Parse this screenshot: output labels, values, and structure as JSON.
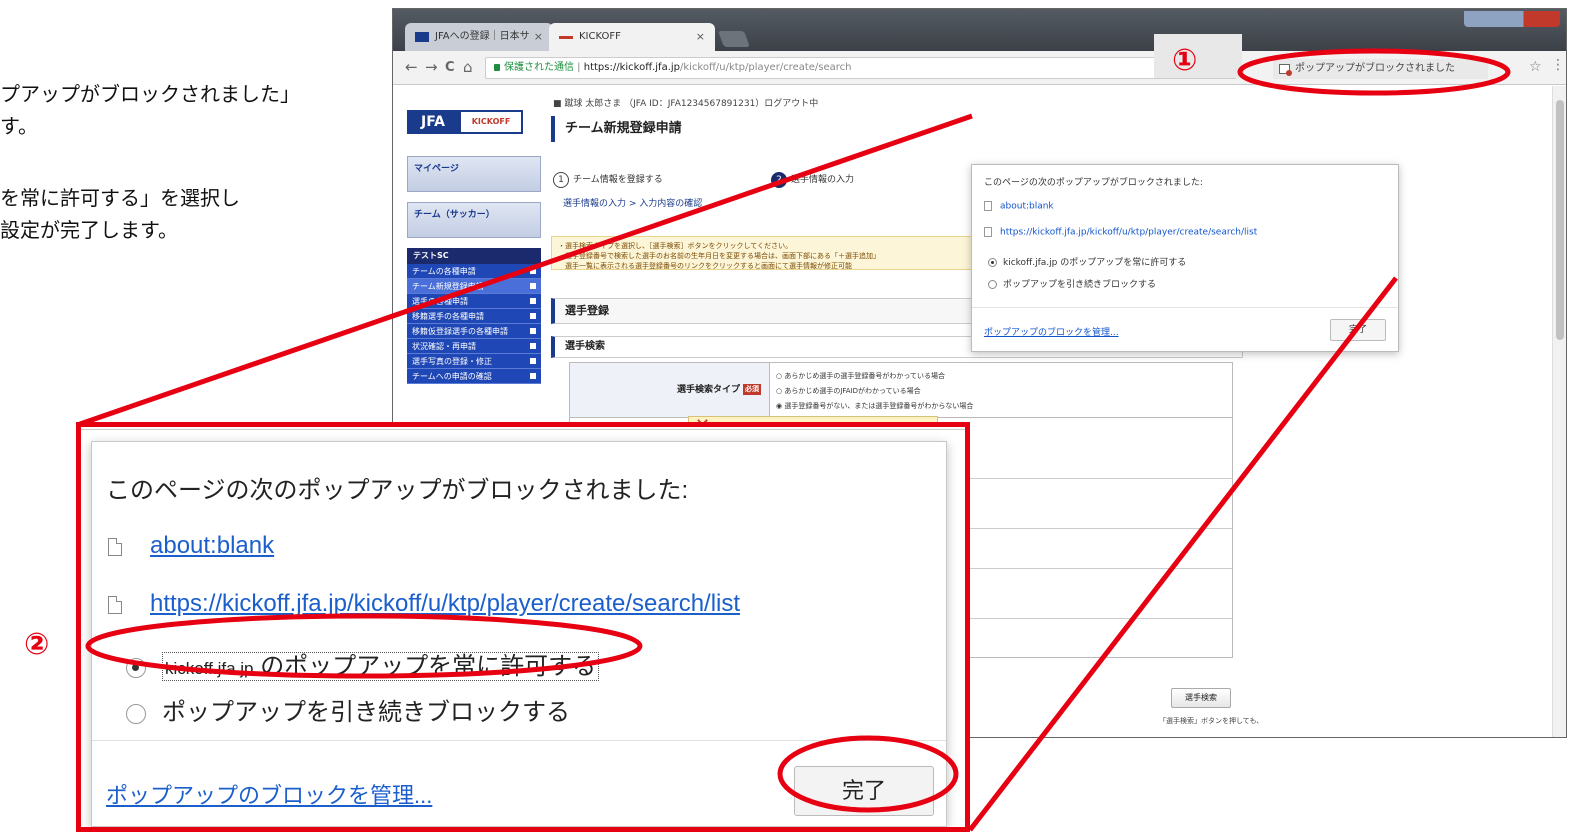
{
  "instructions": {
    "line1": "プアップがブロックされました」",
    "line2": "す。",
    "line3": "を常に許可する」を選択し",
    "line4": "設定が完了します。"
  },
  "browser": {
    "tabs": [
      {
        "label": "JFAへの登録｜日本サ"
      },
      {
        "label": "KICKOFF"
      }
    ],
    "tab_close": "×",
    "nav": {
      "back": "←",
      "forward": "→",
      "reload": "C",
      "home": "⌂"
    },
    "address": {
      "secure_label": "保護された通信",
      "host": "https://kickoff.jfa.jp",
      "path": "/kickoff/u/ktp/player/create/search"
    },
    "blocked_indicator": "ポップアップがブロックされました",
    "star": "☆",
    "menu": "⋮"
  },
  "page": {
    "logo_left": "JFA",
    "logo_right": "KICKOFF",
    "user_line": "■ 蹴球 太郎さま （JFA ID：JFA1234567891231）ログアウト中",
    "heading": "チーム新規登録申請",
    "sidenav": {
      "card1": "マイページ",
      "card2": "チーム（サッカー）",
      "head": "テストSC",
      "items": [
        "チームの各種申請",
        "チーム新規登録申請",
        "選手の各種申請",
        "移籍選手の各種申請",
        "移籍仮登録選手の各種申請",
        "状況確認・再申請",
        "選手写真の登録・修正",
        "チームへの申請の確認"
      ]
    },
    "steps": {
      "step1_num": "1",
      "step1": "チーム情報を登録する",
      "step1_sub": "選手情報の入力 > 入力内容の確認",
      "step2_num": "2",
      "step2": "選手情報の入力"
    },
    "notice": [
      "・選手検索タイプを選択し、［選手検索］ボタンをクリックしてください。",
      "　選手登録番号で検索した選手のお名前の生年月日を変更する場合は、画面下部にある「＋選手追加」",
      "　選手一覧に表示される選手登録番号のリンクをクリックすると画面にて選手情報が修正可能"
    ],
    "section1": "選手登録",
    "section2": "選手検索",
    "search_type_label": "選手検索タイプ",
    "required": "必須",
    "options": [
      "あらかじめ選手の選手登録番号がわかっている場合",
      "あらかじめ選手のJFAIDがわかっている場合",
      "選手登録番号がない、または選手登録番号がわからない場合"
    ],
    "search_button": "選手検索",
    "search_note": "「選手検索」ボタンを押しても、"
  },
  "popup_small": {
    "title": "このページの次のポップアップがブロックされました:",
    "link1": "about:blank",
    "link2": "https://kickoff.jfa.jp/kickoff/u/ktp/player/create/search/list",
    "radio1": "kickoff.jfa.jp のポップアップを常に許可する",
    "radio2": "ポップアップを引き続きブロックする",
    "manage": "ポップアップのブロックを管理...",
    "done": "完了"
  },
  "popup_zoom": {
    "title": "このページの次のポップアップがブロックされました:",
    "link1": "about:blank",
    "link2": "https://kickoff.jfa.jp/kickoff/u/ktp/player/create/search/list",
    "radio1_domain": "kickoff.jfa.jp",
    "radio1_rest": "のポップアップを常に許可する",
    "radio2": "ポップアップを引き続きブロックする",
    "manage": "ポップアップのブロックを管理...",
    "done": "完了"
  },
  "annotations": {
    "marker1": "①",
    "marker2": "②",
    "color": "#e60012"
  }
}
